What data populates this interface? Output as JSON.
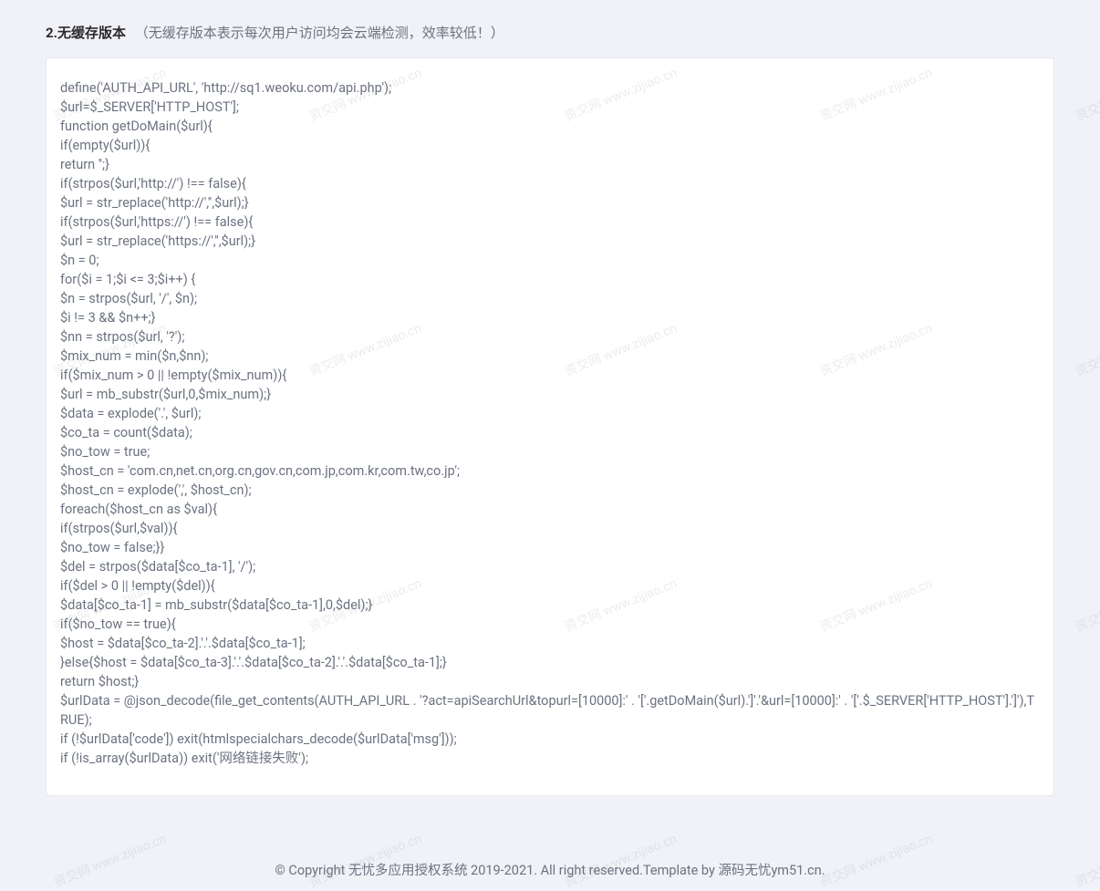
{
  "section": {
    "title": "2.无缓存版本",
    "description": "（无缓存版本表示每次用户访问均会云端检测，效率较低！）"
  },
  "code": "define('AUTH_API_URL', 'http://sq1.weoku.com/api.php');\n$url=$_SERVER['HTTP_HOST'];\nfunction getDoMain($url){\nif(empty($url)){\nreturn '';}\nif(strpos($url,'http://') !== false){\n$url = str_replace('http://','',$url);}\nif(strpos($url,'https://') !== false){\n$url = str_replace('https://','',$url);}\n$n = 0;\nfor($i = 1;$i <= 3;$i++) {\n$n = strpos($url, '/', $n);\n$i != 3 && $n++;}\n$nn = strpos($url, '?');\n$mix_num = min($n,$nn);\nif($mix_num > 0 || !empty($mix_num)){\n$url = mb_substr($url,0,$mix_num);}\n$data = explode('.', $url);\n$co_ta = count($data);\n$no_tow = true;\n$host_cn = 'com.cn,net.cn,org.cn,gov.cn,com.jp,com.kr,com.tw,co.jp';\n$host_cn = explode(',', $host_cn);\nforeach($host_cn as $val){\nif(strpos($url,$val)){\n$no_tow = false;}}\n$del = strpos($data[$co_ta-1], '/');\nif($del > 0 || !empty($del)){\n$data[$co_ta-1] = mb_substr($data[$co_ta-1],0,$del);}\nif($no_tow == true){\n$host = $data[$co_ta-2].'.'.$data[$co_ta-1];\n}else{$host = $data[$co_ta-3].'.'.$data[$co_ta-2].'.'.$data[$co_ta-1];}\nreturn $host;}\n$urlData = @json_decode(file_get_contents(AUTH_API_URL . '?act=apiSearchUrl&topurl=[10000]:' . '['.getDoMain($url).']'.'&url=[10000]:' . '['.$_SERVER['HTTP_HOST'].']'),TRUE);\nif (!$urlData['code']) exit(htmlspecialchars_decode($urlData['msg']));\nif (!is_array($urlData)) exit('网络链接失败');",
  "footer": {
    "text": "© Copyright 无忧多应用授权系统 2019-2021. All right reserved.Template by 源码无忧ym51.cn."
  },
  "watermark": {
    "text": "资交网\nwww.zijiao.cn"
  }
}
